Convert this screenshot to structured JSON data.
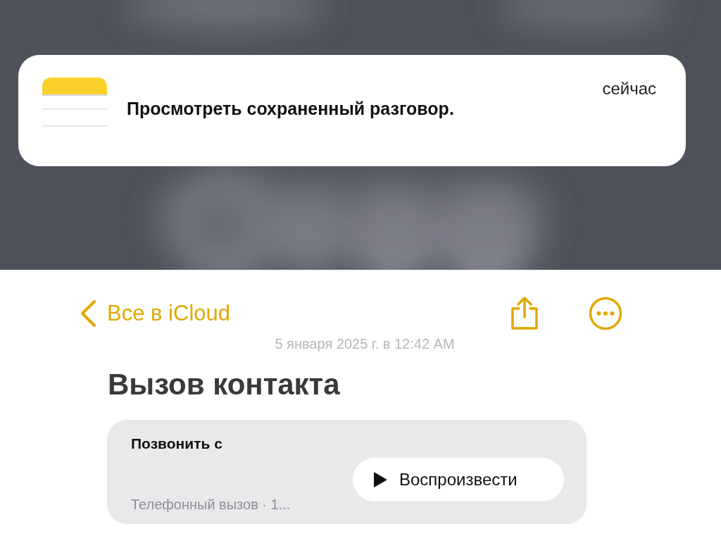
{
  "notification": {
    "message": "Просмотреть сохраненный разговор.",
    "time": "сейчас"
  },
  "nav": {
    "back_label": "Все в iCloud"
  },
  "note": {
    "date": "5 января 2025 г. в 12:42 AM",
    "title": "Вызов контакта",
    "recording": {
      "title": "Позвонить с",
      "subtitle": "Телефонный вызов · 1...",
      "play_label": "Воспроизвести"
    }
  }
}
